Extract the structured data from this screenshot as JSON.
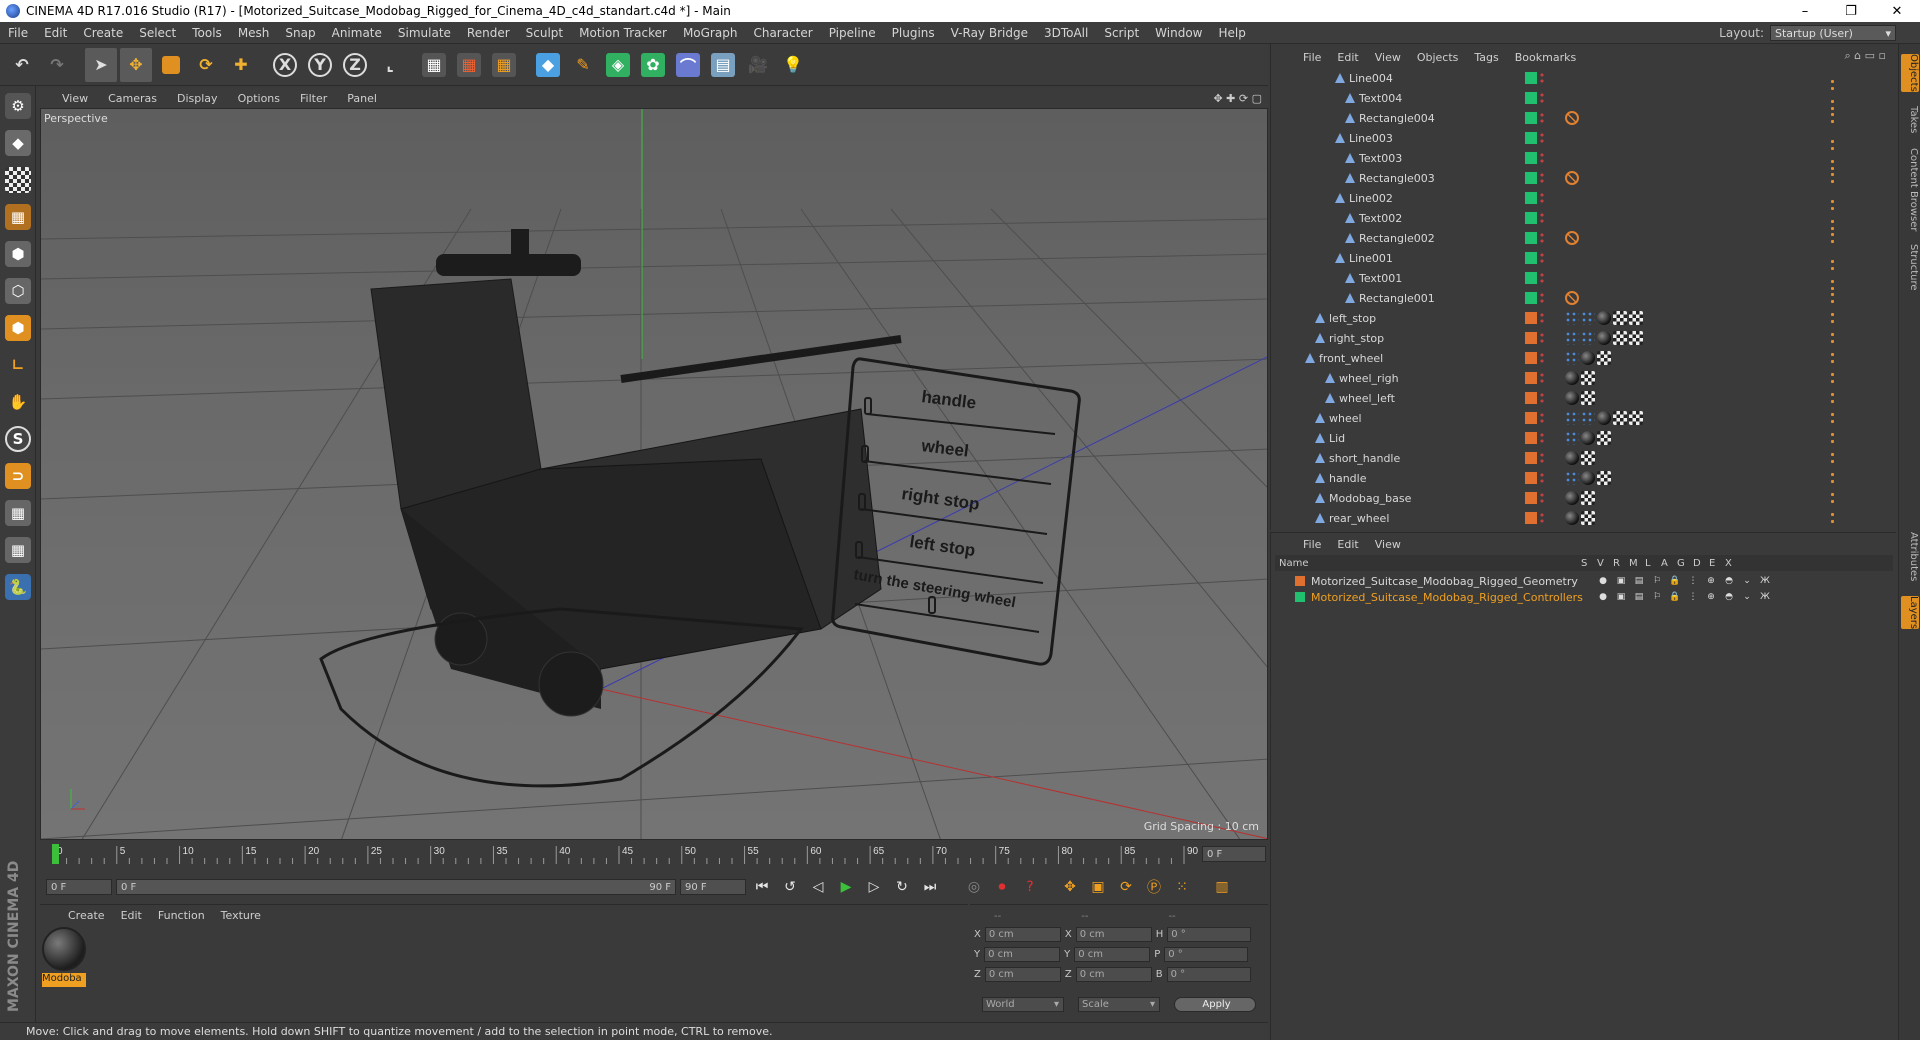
{
  "window": {
    "title": "CINEMA 4D R17.016 Studio (R17) - [Motorized_Suitcase_Modobag_Rigged_for_Cinema_4D_c4d_standart.c4d *] - Main",
    "minimize": "–",
    "restore": "❐",
    "close": "✕"
  },
  "menubar": [
    "File",
    "Edit",
    "Create",
    "Select",
    "Tools",
    "Mesh",
    "Snap",
    "Animate",
    "Simulate",
    "Render",
    "Sculpt",
    "Motion Tracker",
    "MoGraph",
    "Character",
    "Pipeline",
    "Plugins",
    "V-Ray Bridge",
    "3DToAll",
    "Script",
    "Window",
    "Help"
  ],
  "layout": {
    "label": "Layout:",
    "value": "Startup (User)"
  },
  "viewport": {
    "menu": [
      "View",
      "Cameras",
      "Display",
      "Options",
      "Filter",
      "Panel"
    ],
    "camera_label": "Perspective",
    "grid_spacing": "Grid Spacing : 10 cm",
    "panel_labels": [
      "handle",
      "wheel",
      "right stop",
      "left stop",
      "turn the steering wheel"
    ]
  },
  "timeline": {
    "ticks": [
      "0",
      "5",
      "10",
      "15",
      "20",
      "25",
      "30",
      "35",
      "40",
      "45",
      "50",
      "55",
      "60",
      "65",
      "70",
      "75",
      "80",
      "85",
      "90"
    ],
    "current_frame": "0 F",
    "start": "0 F",
    "range_start": "0 F",
    "range_end": "90 F",
    "end": "90 F"
  },
  "material_manager": {
    "menu": [
      "Create",
      "Edit",
      "Function",
      "Texture"
    ],
    "material_name": "Modoba"
  },
  "coordinates": {
    "headers": [
      "--",
      "--",
      "--"
    ],
    "rows": [
      {
        "a": "X",
        "av": "0 cm",
        "b": "X",
        "bv": "0 cm",
        "c": "H",
        "cv": "0 °"
      },
      {
        "a": "Y",
        "av": "0 cm",
        "b": "Y",
        "bv": "0 cm",
        "c": "P",
        "cv": "0 °"
      },
      {
        "a": "Z",
        "av": "0 cm",
        "b": "Z",
        "bv": "0 cm",
        "c": "B",
        "cv": "0 °"
      }
    ],
    "space": "World",
    "mode": "Scale",
    "apply": "Apply"
  },
  "status": "Move: Click and drag to move elements. Hold down SHIFT to quantize movement / add to the selection in point mode, CTRL to remove.",
  "branding": "MAXON CINEMA 4D",
  "object_manager": {
    "menu": [
      "File",
      "Edit",
      "View",
      "Objects",
      "Tags",
      "Bookmarks"
    ],
    "objects": [
      {
        "name": "Line004",
        "indent": 3,
        "color": "#20c070",
        "tags": [
          "dots"
        ]
      },
      {
        "name": "Text004",
        "indent": 4,
        "color": "#20c070",
        "tags": [
          "dots"
        ]
      },
      {
        "name": "Rectangle004",
        "indent": 4,
        "color": "#20c070",
        "tags": [
          "stop",
          "dots"
        ]
      },
      {
        "name": "Line003",
        "indent": 3,
        "color": "#20c070",
        "tags": [
          "dots"
        ]
      },
      {
        "name": "Text003",
        "indent": 4,
        "color": "#20c070",
        "tags": [
          "dots"
        ]
      },
      {
        "name": "Rectangle003",
        "indent": 4,
        "color": "#20c070",
        "tags": [
          "stop",
          "dots"
        ]
      },
      {
        "name": "Line002",
        "indent": 3,
        "color": "#20c070",
        "tags": [
          "dots"
        ]
      },
      {
        "name": "Text002",
        "indent": 4,
        "color": "#20c070",
        "tags": [
          "dots"
        ]
      },
      {
        "name": "Rectangle002",
        "indent": 4,
        "color": "#20c070",
        "tags": [
          "stop",
          "dots"
        ]
      },
      {
        "name": "Line001",
        "indent": 3,
        "color": "#20c070",
        "tags": [
          "dots"
        ]
      },
      {
        "name": "Text001",
        "indent": 4,
        "color": "#20c070",
        "tags": [
          "dots"
        ]
      },
      {
        "name": "Rectangle001",
        "indent": 4,
        "color": "#20c070",
        "tags": [
          "stop",
          "dots"
        ]
      },
      {
        "name": "left_stop",
        "indent": 1,
        "color": "#e07030",
        "tags": [
          "xpr",
          "xpr",
          "ball",
          "checker",
          "checker",
          "dots"
        ]
      },
      {
        "name": "right_stop",
        "indent": 1,
        "color": "#e07030",
        "tags": [
          "xpr",
          "xpr",
          "ball",
          "checker",
          "checker",
          "dots"
        ]
      },
      {
        "name": "front_wheel",
        "indent": 0,
        "color": "#e07030",
        "tags": [
          "xpr",
          "ball",
          "checker",
          "dots"
        ]
      },
      {
        "name": "wheel_righ",
        "indent": 2,
        "color": "#e07030",
        "tags": [
          "ball",
          "checker",
          "dots"
        ]
      },
      {
        "name": "wheel_left",
        "indent": 2,
        "color": "#e07030",
        "tags": [
          "ball",
          "checker",
          "dots"
        ]
      },
      {
        "name": "wheel",
        "indent": 1,
        "color": "#e07030",
        "tags": [
          "xpr",
          "xpr",
          "ball",
          "checker",
          "checker",
          "dots"
        ]
      },
      {
        "name": "Lid",
        "indent": 1,
        "color": "#e07030",
        "tags": [
          "xpr",
          "ball",
          "checker",
          "dots"
        ]
      },
      {
        "name": "short_handle",
        "indent": 1,
        "color": "#e07030",
        "tags": [
          "ball",
          "checker",
          "dots"
        ]
      },
      {
        "name": "handle",
        "indent": 1,
        "color": "#e07030",
        "tags": [
          "xpr",
          "ball",
          "checker",
          "dots"
        ]
      },
      {
        "name": "Modobag_base",
        "indent": 1,
        "color": "#e07030",
        "tags": [
          "ball",
          "checker",
          "dots"
        ]
      },
      {
        "name": "rear_wheel",
        "indent": 1,
        "color": "#e07030",
        "tags": [
          "ball",
          "checker",
          "dots"
        ]
      }
    ]
  },
  "layer_manager": {
    "menu": [
      "File",
      "Edit",
      "View"
    ],
    "columns": [
      "Name",
      "S",
      "V",
      "R",
      "M",
      "L",
      "A",
      "G",
      "D",
      "E",
      "X"
    ],
    "layers": [
      {
        "name": "Motorized_Suitcase_Modobag_Rigged_Geometry",
        "color": "#e07030",
        "text_color": "#d8d8d8"
      },
      {
        "name": "Motorized_Suitcase_Modobag_Rigged_Controllers",
        "color": "#20c070",
        "text_color": "#f0a020"
      }
    ]
  },
  "right_tabs": [
    "Objects",
    "Takes",
    "Content Browser",
    "Structure",
    "Attributes",
    "Layers"
  ],
  "colors": {
    "accent": "#f0a020",
    "green": "#20c070",
    "orange": "#e07030",
    "blue_axis": "#3f51b5"
  }
}
